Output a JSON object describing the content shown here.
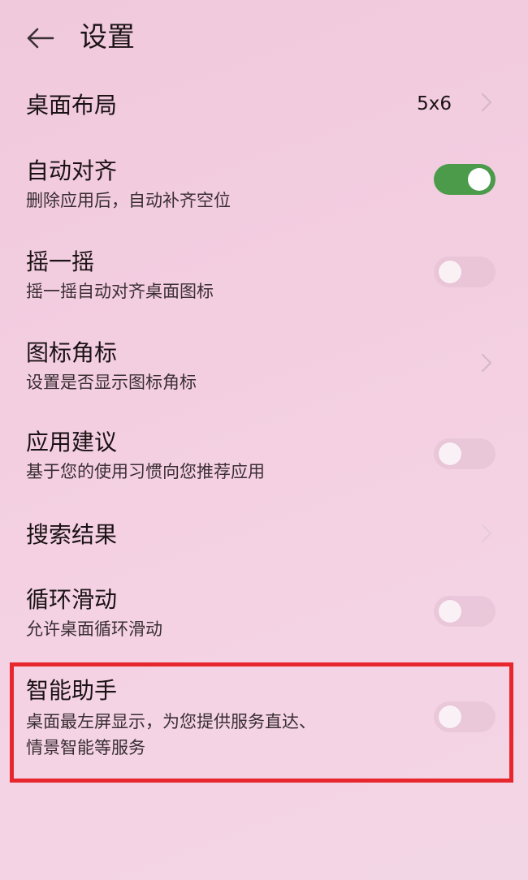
{
  "header": {
    "title": "设置"
  },
  "settings": {
    "layout": {
      "title": "桌面布局",
      "value": "5x6"
    },
    "auto_align": {
      "title": "自动对齐",
      "subtitle": "删除应用后，自动补齐空位",
      "enabled": true
    },
    "shake": {
      "title": "摇一摇",
      "subtitle": "摇一摇自动对齐桌面图标",
      "enabled": false
    },
    "badges": {
      "title": "图标角标",
      "subtitle": "设置是否显示图标角标"
    },
    "suggestions": {
      "title": "应用建议",
      "subtitle": "基于您的使用习惯向您推荐应用",
      "enabled": false
    },
    "search": {
      "title": "搜索结果"
    },
    "loop_scroll": {
      "title": "循环滑动",
      "subtitle": "允许桌面循环滑动",
      "enabled": false
    },
    "assistant": {
      "title": "智能助手",
      "subtitle_line1": "桌面最左屏显示，为您提供服务直达、",
      "subtitle_line2": "情景智能等服务",
      "enabled": false
    }
  },
  "colors": {
    "toggle_on": "#4b9b4a",
    "highlight_border": "#e8262e"
  },
  "icons": {
    "back": "arrow-left-icon",
    "chevron": "chevron-right-icon"
  }
}
